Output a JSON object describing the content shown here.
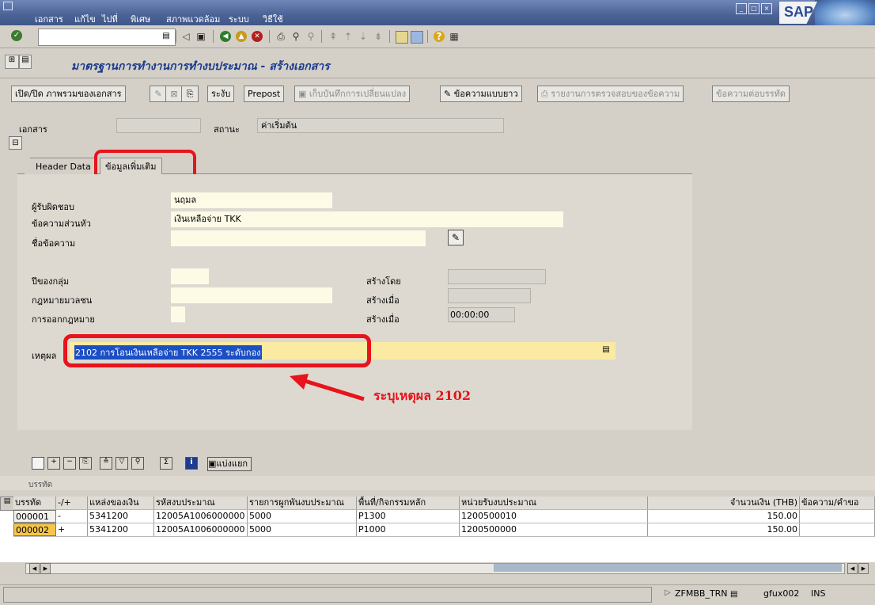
{
  "menu": [
    "เอกสาร",
    "แก้ไข",
    "ไปที่",
    "พิเศษ",
    "สภาพแวดล้อม",
    "ระบบ",
    "วิธีใช้"
  ],
  "brand": "SAP",
  "screen_title": "มาตรฐานการทำงานการทำงบประมาณ - สร้างเอกสาร",
  "app_toolbar": {
    "toggle_overview": "เปิด/ปิด ภาพรวมของเอกสาร",
    "hold": "ระงับ",
    "prepost": "Prepost",
    "save_changes": "เก็บบันทึกการเปลี่ยนแปลง",
    "long_text": "ข้อความแบบยาว",
    "text_check_report": "รายงานการตรวจสอบของข้อความ",
    "line_text": "ข้อความต่อบรรทัด"
  },
  "header": {
    "document_label": "เอกสาร",
    "document_value": "",
    "status_label": "สถานะ",
    "status_value": "ค่าเริ่มต้น"
  },
  "tabs": [
    {
      "label": "Header Data"
    },
    {
      "label": "ข้อมูลเพิ่มเติม"
    }
  ],
  "form": {
    "responsible_label": "ผู้รับผิดชอบ",
    "responsible_value": "นฤมล",
    "header_text_label": "ข้อความส่วนหัว",
    "header_text_value": "เงินเหลือจ่าย TKK",
    "text_name_label": "ชื่อข้อความ",
    "text_name_value": "",
    "group_year_label": "ปีของกลุ่ม",
    "group_year_value": "",
    "public_law_label": "กฎหมายมวลชน",
    "public_law_value": "",
    "law_issue_label": "การออกกฎหมาย",
    "created_by_label": "สร้างโดย",
    "created_by_value": "",
    "created_on_label": "สร้างเมื่อ",
    "created_on_value": "",
    "created_at_label": "สร้างเมื่อ",
    "created_at_value": "00:00:00",
    "reason_label": "เหตุผล",
    "reason_value": "2102 การโอนเงินเหลือจ่าย TKK 2555 ระดับกอง"
  },
  "annotation": {
    "text": "ระบุเหตุผล 2102",
    "color": "#e8131b"
  },
  "grid": {
    "split_label": "แบ่งแยก",
    "section_label": "บรรทัด",
    "columns": [
      "บรรทัด",
      "-/+",
      "แหล่งของเงิน",
      "รหัสงบประมาณ",
      "รายการผูกพันงบประมาณ",
      "พื้นที่/กิจกรรมหลัก",
      "หน่วยรับงบประมาณ",
      "จำนวนเงิน (THB)",
      "ข้อความ/คำขอ"
    ],
    "rows": [
      [
        "000001",
        "-",
        "5341200",
        "12005A1006000000",
        "5000",
        "P1300",
        "1200500010",
        "150.00",
        ""
      ],
      [
        "000002",
        "+",
        "5341200",
        "12005A1006000000",
        "5000",
        "P1000",
        "1200500000",
        "150.00",
        ""
      ]
    ]
  },
  "status_bar": {
    "transaction": "ZFMBB_TRN",
    "server": "gfux002",
    "mode": "INS"
  }
}
